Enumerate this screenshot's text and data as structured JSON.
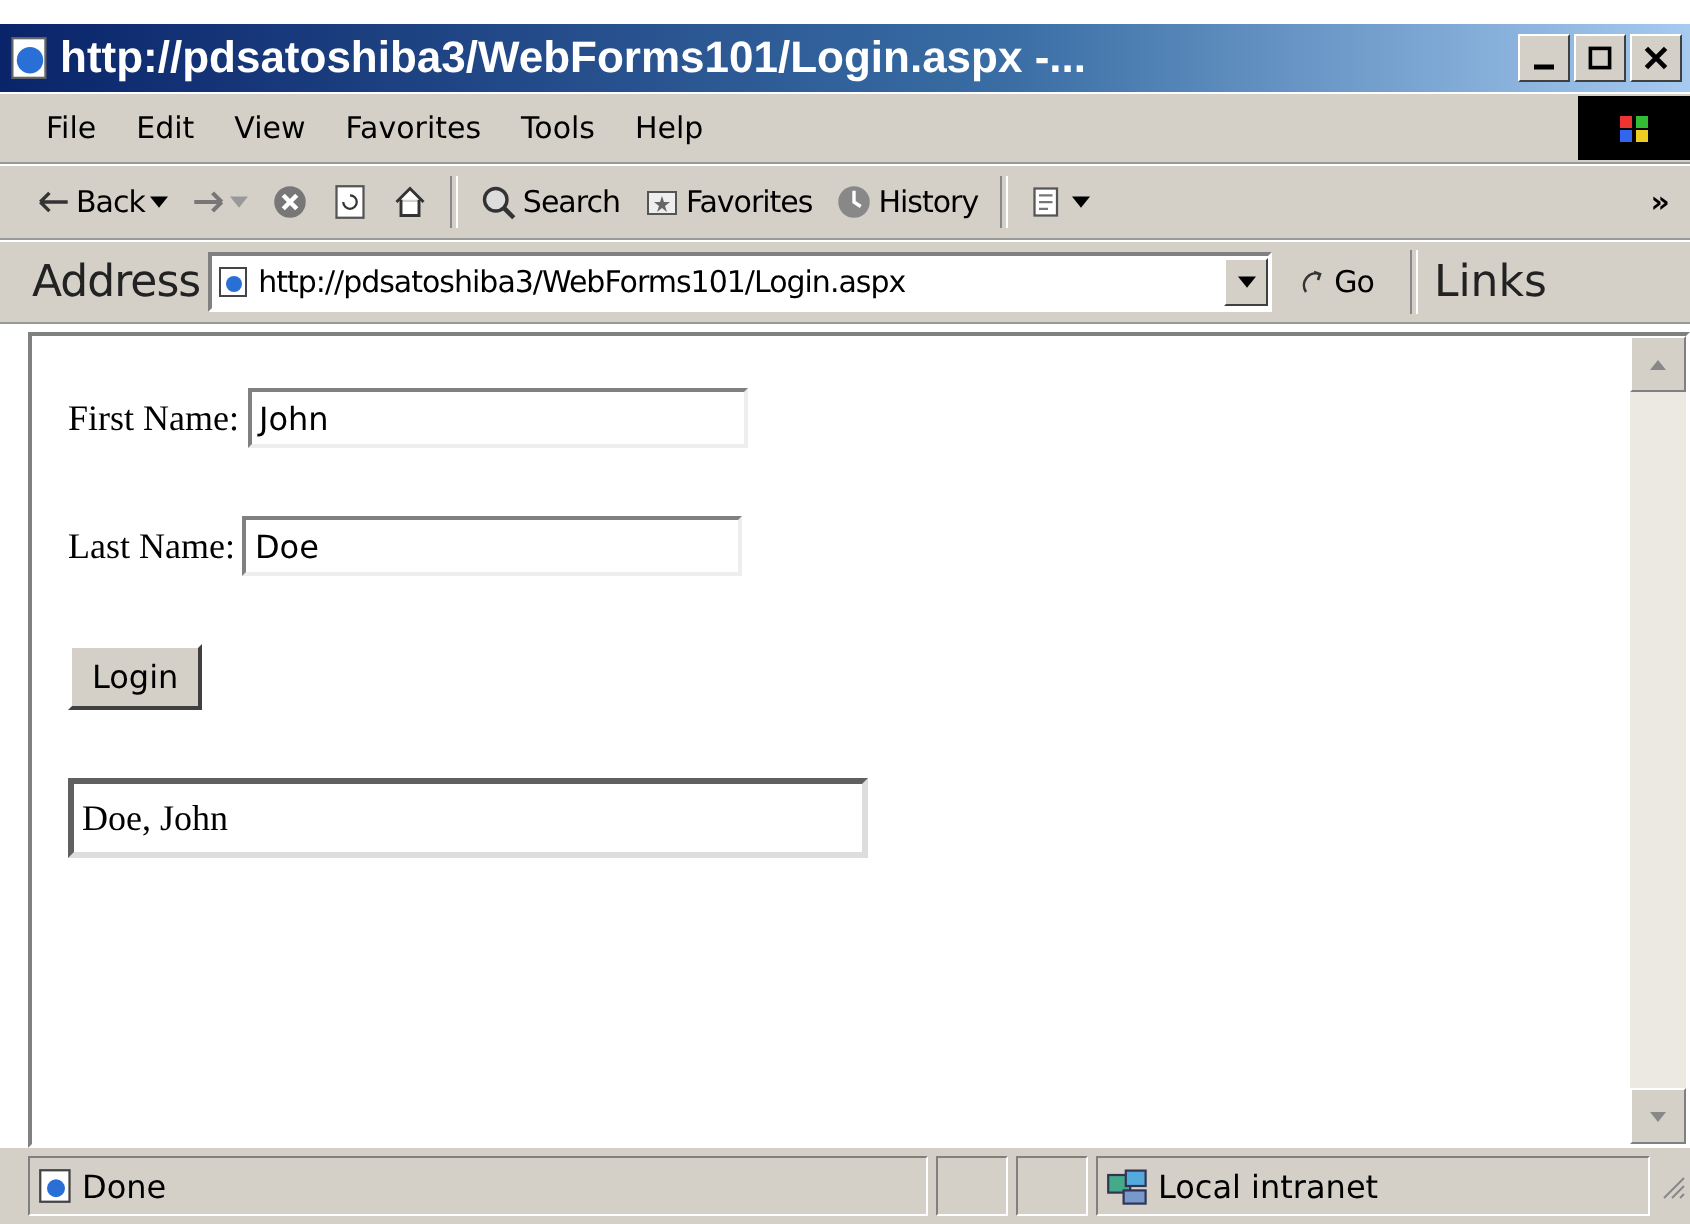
{
  "window": {
    "title": "http://pdsatoshiba3/WebForms101/Login.aspx -..."
  },
  "menu": [
    "File",
    "Edit",
    "View",
    "Favorites",
    "Tools",
    "Help"
  ],
  "toolbar": [
    {
      "kind": "back",
      "label": "Back"
    },
    {
      "kind": "forward"
    },
    {
      "kind": "stop"
    },
    {
      "kind": "refresh"
    },
    {
      "kind": "home"
    },
    {
      "kind": "search",
      "label": "Search"
    },
    {
      "kind": "favorites",
      "label": "Favorites"
    },
    {
      "kind": "history",
      "label": "History"
    },
    {
      "kind": "edit"
    }
  ],
  "toolbar_more": "»",
  "address": {
    "label": "Address",
    "value": "http://pdsatoshiba3/WebForms101/Login.aspx",
    "go": "Go",
    "links": "Links"
  },
  "form": {
    "fields": [
      {
        "label": "First Name:",
        "value": "John"
      },
      {
        "label": "Last Name:",
        "value": "Doe"
      }
    ],
    "button": "Login",
    "output": "Doe, John"
  },
  "status_bar": {
    "text": "Done",
    "zone": "Local intranet"
  }
}
